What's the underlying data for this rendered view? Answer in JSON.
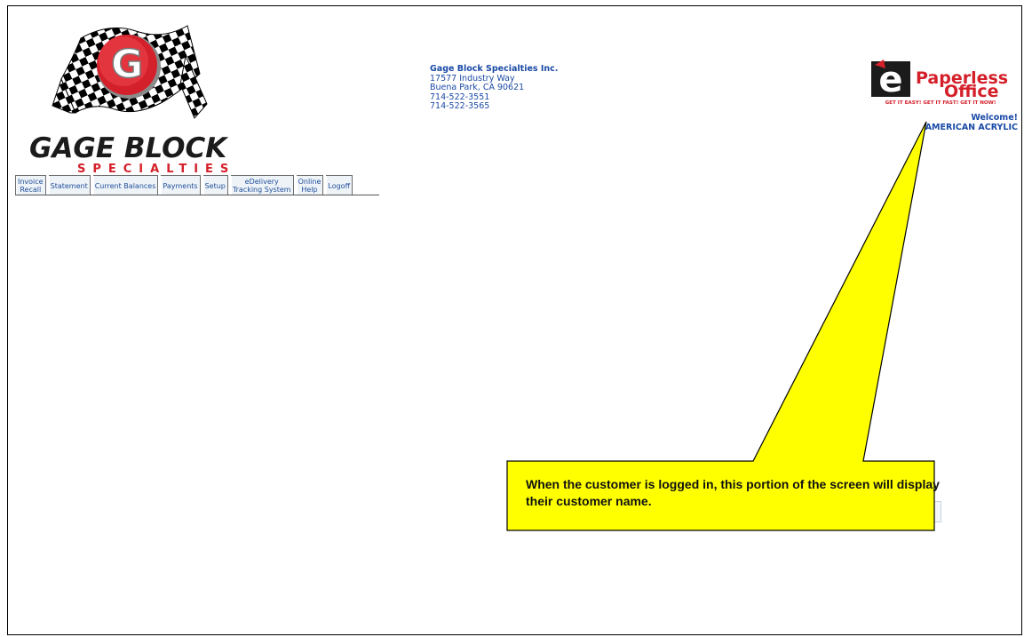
{
  "logo": {
    "title": "GAGE BLOCK",
    "subtitle": "SPECIALTIES",
    "letter": "G"
  },
  "nav": {
    "items": [
      {
        "label": "Invoice\nRecall"
      },
      {
        "label": "Statement"
      },
      {
        "label": "Current Balances"
      },
      {
        "label": "Payments"
      },
      {
        "label": "Setup"
      },
      {
        "label": "eDelivery\nTracking System"
      },
      {
        "label": "Online\nHelp"
      },
      {
        "label": "Logoff"
      }
    ]
  },
  "company": {
    "name": "Gage Block Specialties Inc.",
    "address1": "17577 Industry Way",
    "address2": "Buena Park, CA 90621",
    "phone1": "714-522-3551",
    "phone2": "714-522-3565"
  },
  "badge": {
    "letter": "e",
    "word1": "Paperless",
    "word2": "Office",
    "tagline": "GET IT EASY! GET IT FAST! GET IT NOW!"
  },
  "welcome": {
    "greeting": "Welcome!",
    "customer": "AMERICAN ACRYLIC"
  },
  "callout": {
    "text": "When the customer is logged in, this portion of the screen will display their customer name.",
    "fill": "#ffff00"
  },
  "colors": {
    "link_blue": "#1a4aa6",
    "brand_red": "#d4202a"
  }
}
